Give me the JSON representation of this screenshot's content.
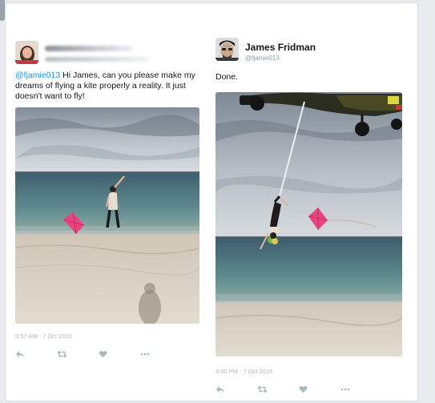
{
  "left_tweet": {
    "handle": "",
    "mention": "@fjamie013",
    "text": " Hi James, can you please make my dreams of flying a kite properly a reality. It just doesn't want to fly!",
    "timestamp": "3:57 AM - 7 Oct 2016",
    "icons": [
      "reply-icon",
      "retweet-icon",
      "like-icon",
      "more-icon"
    ]
  },
  "right_tweet": {
    "name": "James Fridman",
    "handle": "@fjamie013",
    "text": "Done.",
    "timestamp": "4:00 PM - 7 Oct 2016",
    "icons": [
      "reply-icon",
      "retweet-icon",
      "like-icon",
      "more-icon"
    ]
  },
  "colors": {
    "link": "#1b95e0",
    "muted": "#aab8c2",
    "kite": "#e8457d"
  }
}
